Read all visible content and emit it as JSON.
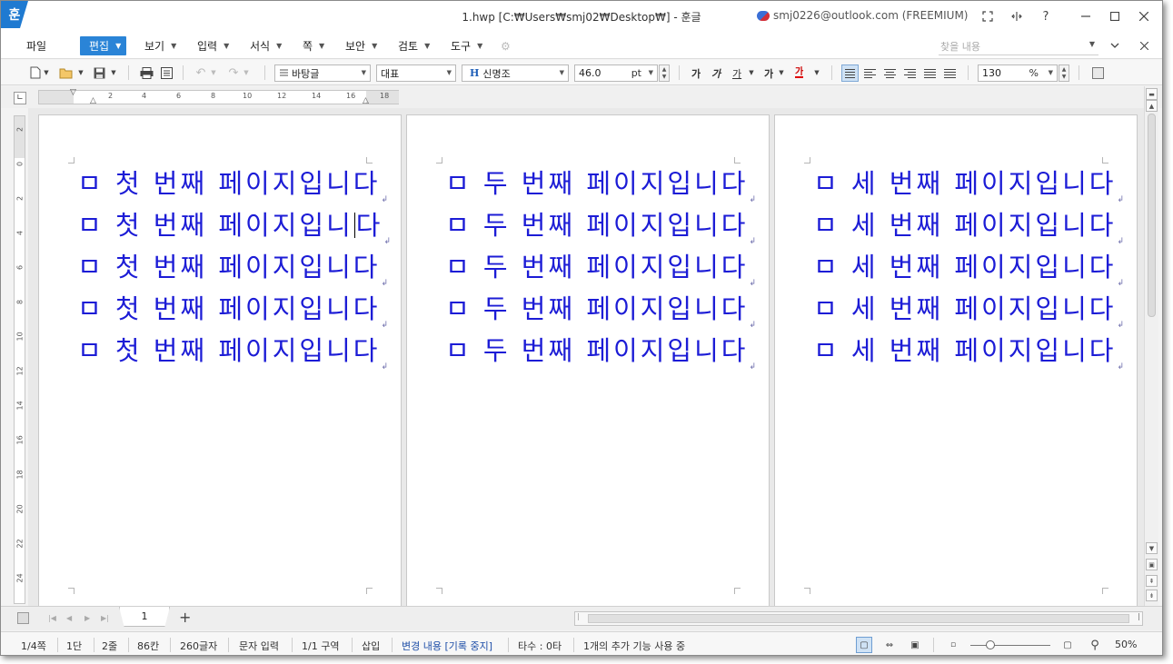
{
  "window": {
    "app_icon": "훈",
    "title": "1.hwp [C:₩Users₩smj02₩Desktop₩] - 훈글",
    "account": "smj0226@outlook.com (FREEMIUM)",
    "controls": [
      "restore-fullscreen-icon",
      "split-icon",
      "help-icon",
      "minimize-icon",
      "maximize-icon",
      "close-icon"
    ],
    "help_label": "?"
  },
  "menu": {
    "items": [
      {
        "label": "파일"
      },
      {
        "label": "편집"
      },
      {
        "label": "보기"
      },
      {
        "label": "입력"
      },
      {
        "label": "서식"
      },
      {
        "label": "쪽"
      },
      {
        "label": "보안"
      },
      {
        "label": "검토"
      },
      {
        "label": "도구"
      }
    ],
    "active": "편집",
    "find_placeholder": "찾을 내용"
  },
  "toolbar": {
    "style": "바탕글",
    "language": "대표",
    "font": "신명조",
    "font_icon": "H",
    "size": "46.0",
    "size_unit": "pt",
    "format_buttons": [
      "가",
      "가",
      "가",
      "가",
      "가"
    ],
    "zoom": "130",
    "zoom_unit": "%"
  },
  "ruler": {
    "h_numbers": [
      "2",
      "4",
      "6",
      "8",
      "10",
      "12",
      "14",
      "16",
      "18"
    ],
    "v_numbers": [
      "2",
      "0",
      "2",
      "4",
      "6",
      "8",
      "10",
      "12",
      "14",
      "16",
      "18",
      "20",
      "22",
      "24"
    ]
  },
  "pages": [
    {
      "lines": [
        "ㅁ 첫 번째 페이지입니다",
        "ㅁ 첫 번째 페이지입니다",
        "ㅁ 첫 번째 페이지입니다",
        "ㅁ 첫 번째 페이지입니다",
        "ㅁ 첫 번째 페이지입니다"
      ]
    },
    {
      "lines": [
        "ㅁ 두 번째 페이지입니다",
        "ㅁ 두 번째 페이지입니다",
        "ㅁ 두 번째 페이지입니다",
        "ㅁ 두 번째 페이지입니다",
        "ㅁ 두 번째 페이지입니다"
      ]
    },
    {
      "lines": [
        "ㅁ 세 번째 페이지입니다",
        "ㅁ 세 번째 페이지입니다",
        "ㅁ 세 번째 페이지입니다",
        "ㅁ 세 번째 페이지입니다",
        "ㅁ 세 번째 페이지입니다"
      ]
    }
  ],
  "paragraph_mark": "↲",
  "caret_line_prefix": "ㅁ 첫 번째 페이지입니",
  "caret_line_suffix": "다",
  "tabs": {
    "current": "1",
    "add": "+"
  },
  "status": {
    "page": "1/4쪽",
    "column": "1단",
    "line": "2줄",
    "col": "86칸",
    "chars": "260글자",
    "mode": "문자 입력",
    "section": "1/1 구역",
    "insert": "삽입",
    "track": "변경 내용 [기록 중지]",
    "typing": "타수 : 0타",
    "addons": "1개의 추가 기능 사용 중",
    "zoom": "50%"
  },
  "colors": {
    "accent": "#2a84d7",
    "text_blue": "#1c1cd6"
  }
}
